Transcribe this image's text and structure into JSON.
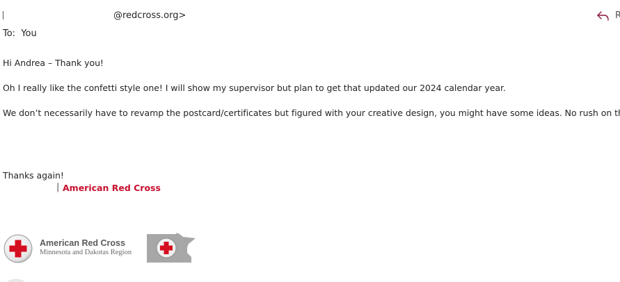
{
  "header": {
    "from_email": "@redcross.org>",
    "to_label": "To:",
    "to_value": "You",
    "reply_icon": "reply-arrow-icon",
    "reply_label_cut": "R"
  },
  "message": {
    "greeting": "Hi Andrea – Thank you!",
    "paragraph1": "Oh I really like the confetti style one! I will show my supervisor but plan to get that updated our 2024 calendar year.",
    "paragraph2": "We don’t necessarily have to revamp the postcard/certificates but figured with your creative design, you might have some ideas. No rush on those.",
    "closing": "Thanks again!"
  },
  "signature": {
    "separator": "|",
    "organization": "American Red Cross",
    "logo_title": "American Red Cross",
    "logo_subtitle": "Minnesota and Dakotas Region"
  },
  "colors": {
    "brand_red": "#c8102e",
    "logo_gray": "#5a5a5a",
    "map_gray": "#a7a7a7",
    "reply_icon": "#8a1538"
  }
}
